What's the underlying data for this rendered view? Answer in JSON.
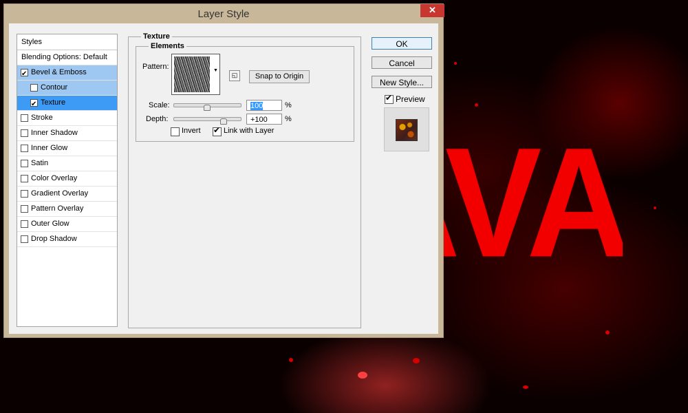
{
  "canvas": {
    "lava_text": "AVA",
    "lava_color": "#f20000"
  },
  "dialog": {
    "title": "Layer Style",
    "close_glyph": "✕"
  },
  "styles_list": {
    "header": "Styles",
    "blending_options": "Blending Options: Default",
    "items": [
      {
        "label": "Bevel & Emboss",
        "checked": true
      },
      {
        "label": "Contour",
        "checked": false
      },
      {
        "label": "Texture",
        "checked": true
      },
      {
        "label": "Stroke",
        "checked": false
      },
      {
        "label": "Inner Shadow",
        "checked": false
      },
      {
        "label": "Inner Glow",
        "checked": false
      },
      {
        "label": "Satin",
        "checked": false
      },
      {
        "label": "Color Overlay",
        "checked": false
      },
      {
        "label": "Gradient Overlay",
        "checked": false
      },
      {
        "label": "Pattern Overlay",
        "checked": false
      },
      {
        "label": "Outer Glow",
        "checked": false
      },
      {
        "label": "Drop Shadow",
        "checked": false
      }
    ]
  },
  "texture": {
    "group_title": "Texture",
    "elements_title": "Elements",
    "pattern_label": "Pattern:",
    "snap_button": "Snap to Origin",
    "scale_label": "Scale:",
    "scale_value": "100",
    "scale_unit": "%",
    "scale_level": 0.5,
    "depth_label": "Depth:",
    "depth_value": "+100",
    "depth_unit": "%",
    "depth_level": 0.75,
    "invert_label": "Invert",
    "invert_checked": false,
    "link_label": "Link with Layer",
    "link_checked": true
  },
  "buttons": {
    "ok": "OK",
    "cancel": "Cancel",
    "new_style": "New Style...",
    "preview_label": "Preview",
    "preview_checked": true
  },
  "colors": {
    "selection_blue": "#3e9bf5",
    "selection_light": "#9ec8f2",
    "close_red": "#c7372f"
  }
}
